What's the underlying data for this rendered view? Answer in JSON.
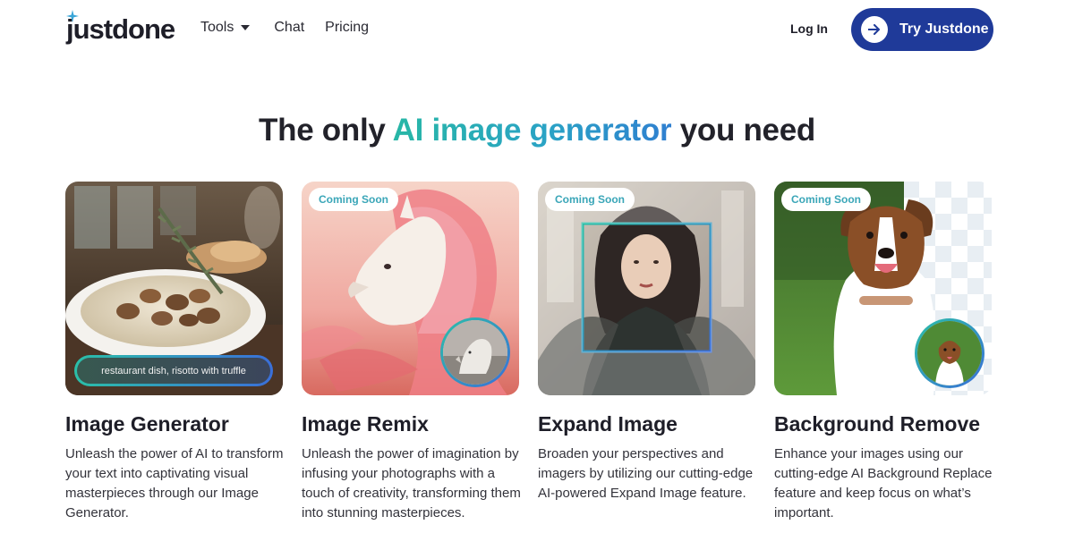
{
  "nav": {
    "logo": "justdone",
    "links": [
      {
        "label": "Tools"
      },
      {
        "label": "Chat"
      },
      {
        "label": "Pricing"
      }
    ],
    "login_label": "Log In",
    "cta_label": "Try Justdone"
  },
  "hero": {
    "headline_prefix": "The only ",
    "headline_highlight": "AI image generator",
    "headline_suffix": " you need"
  },
  "cards": [
    {
      "title": "Image Generator",
      "description": "Unleash the power of AI to transform your text into captivating visual masterpieces through our Image Generator.",
      "prompt": "restaurant dish, risotto with truffle"
    },
    {
      "title": "Image Remix",
      "badge": "Coming Soon",
      "description": "Unleash the power of imagination by infusing your photographs with a touch of creativity, transforming them into stunning masterpieces."
    },
    {
      "title": "Expand Image",
      "badge": "Coming Soon",
      "description": "Broaden your perspectives and imagers by utilizing our cutting-edge AI-powered Expand Image feature."
    },
    {
      "title": "Background Remove",
      "badge": "Coming Soon",
      "description": "Enhance your images using our cutting-edge AI Background Replace feature and keep focus on what’s important."
    }
  ],
  "colors": {
    "cta_background": "#1f3a99",
    "gradient_start": "#28b7a6",
    "gradient_end": "#2f7fd0",
    "badge_text": "#3aa6b8"
  },
  "icons": {
    "logo_spark": "sparkle-icon",
    "tools_chevron": "chevron-down-icon",
    "cta_arrow": "arrow-right-icon"
  }
}
